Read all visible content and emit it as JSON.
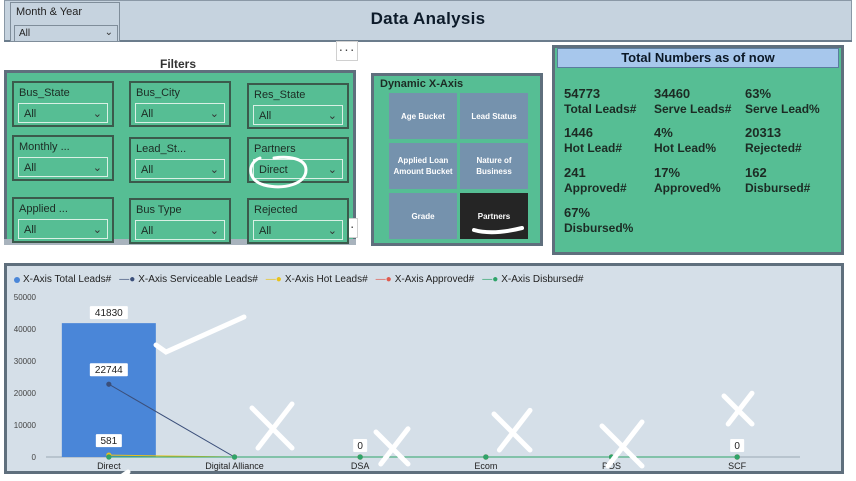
{
  "header": {
    "title": "Data Analysis"
  },
  "month_year": {
    "label": "Month & Year",
    "value": "All"
  },
  "filters": {
    "title": "Filters",
    "more_label": "···",
    "slicers": [
      {
        "label": "Bus_State",
        "value": "All"
      },
      {
        "label": "Bus_City",
        "value": "All"
      },
      {
        "label": "Res_State",
        "value": "All"
      },
      {
        "label": "Monthly ...",
        "value": "All"
      },
      {
        "label": "Lead_St...",
        "value": "All"
      },
      {
        "label": "Partners",
        "value": "Direct"
      },
      {
        "label": "Applied ...",
        "value": "All"
      },
      {
        "label": "Bus Type",
        "value": "All"
      },
      {
        "label": "Rejected",
        "value": "All"
      }
    ]
  },
  "dynamic_x": {
    "title": "Dynamic X-Axis",
    "options": [
      "Age Bucket",
      "Lead Status",
      "Applied Loan Amount Bucket",
      "Nature of Business",
      "Grade",
      "Partners"
    ],
    "selected": "Partners"
  },
  "totals": {
    "title": "Total Numbers as of now",
    "items": [
      {
        "value": "54773",
        "label": "Total Leads#"
      },
      {
        "value": "34460",
        "label": "Serve Leads#"
      },
      {
        "value": "63%",
        "label": "Serve Lead%"
      },
      {
        "value": "1446",
        "label": "Hot Lead#"
      },
      {
        "value": "4%",
        "label": "Hot Lead%"
      },
      {
        "value": "20313",
        "label": "Rejected#"
      },
      {
        "value": "241",
        "label": "Approved#"
      },
      {
        "value": "17%",
        "label": "Approved%"
      },
      {
        "value": "162",
        "label": "Disbursed#"
      },
      {
        "value": "67%",
        "label": "Disbursed%"
      }
    ]
  },
  "chart_data": {
    "type": "bar",
    "categories": [
      "Direct",
      "Digital Alliance",
      "DSA",
      "Ecom",
      "POS",
      "SCF"
    ],
    "ylim": [
      0,
      50000
    ],
    "yticks": [
      0,
      10000,
      20000,
      30000,
      40000,
      50000
    ],
    "legend_position": "top-left",
    "series": [
      {
        "name": "X-Axis Total Leads#",
        "kind": "bar",
        "color": "#4a86d8",
        "values": [
          41830,
          0,
          0,
          0,
          0,
          0
        ],
        "labels": [
          "41830",
          "",
          "0",
          "",
          "",
          "0"
        ]
      },
      {
        "name": "X-Axis Serviceable Leads#",
        "kind": "line",
        "color": "#3b4f7a",
        "values": [
          22744,
          0,
          0,
          0,
          0,
          0
        ],
        "labels": [
          "22744",
          "",
          "",
          "",
          "",
          ""
        ]
      },
      {
        "name": "X-Axis Hot Leads#",
        "kind": "line",
        "color": "#e8c21c",
        "values": [
          581,
          0,
          0,
          0,
          0,
          0
        ],
        "labels": [
          "581",
          "",
          "",
          "",
          "",
          ""
        ]
      },
      {
        "name": "X-Axis Approved#",
        "kind": "line",
        "color": "#e05a4e",
        "values": [
          0,
          0,
          0,
          0,
          0,
          0
        ],
        "labels": [
          "",
          "",
          "",
          "",
          "",
          ""
        ]
      },
      {
        "name": "X-Axis Disbursed#",
        "kind": "line",
        "color": "#2fa46a",
        "values": [
          0,
          0,
          0,
          0,
          0,
          0
        ],
        "labels": [
          "",
          "",
          "",
          "",
          "",
          ""
        ]
      }
    ]
  }
}
